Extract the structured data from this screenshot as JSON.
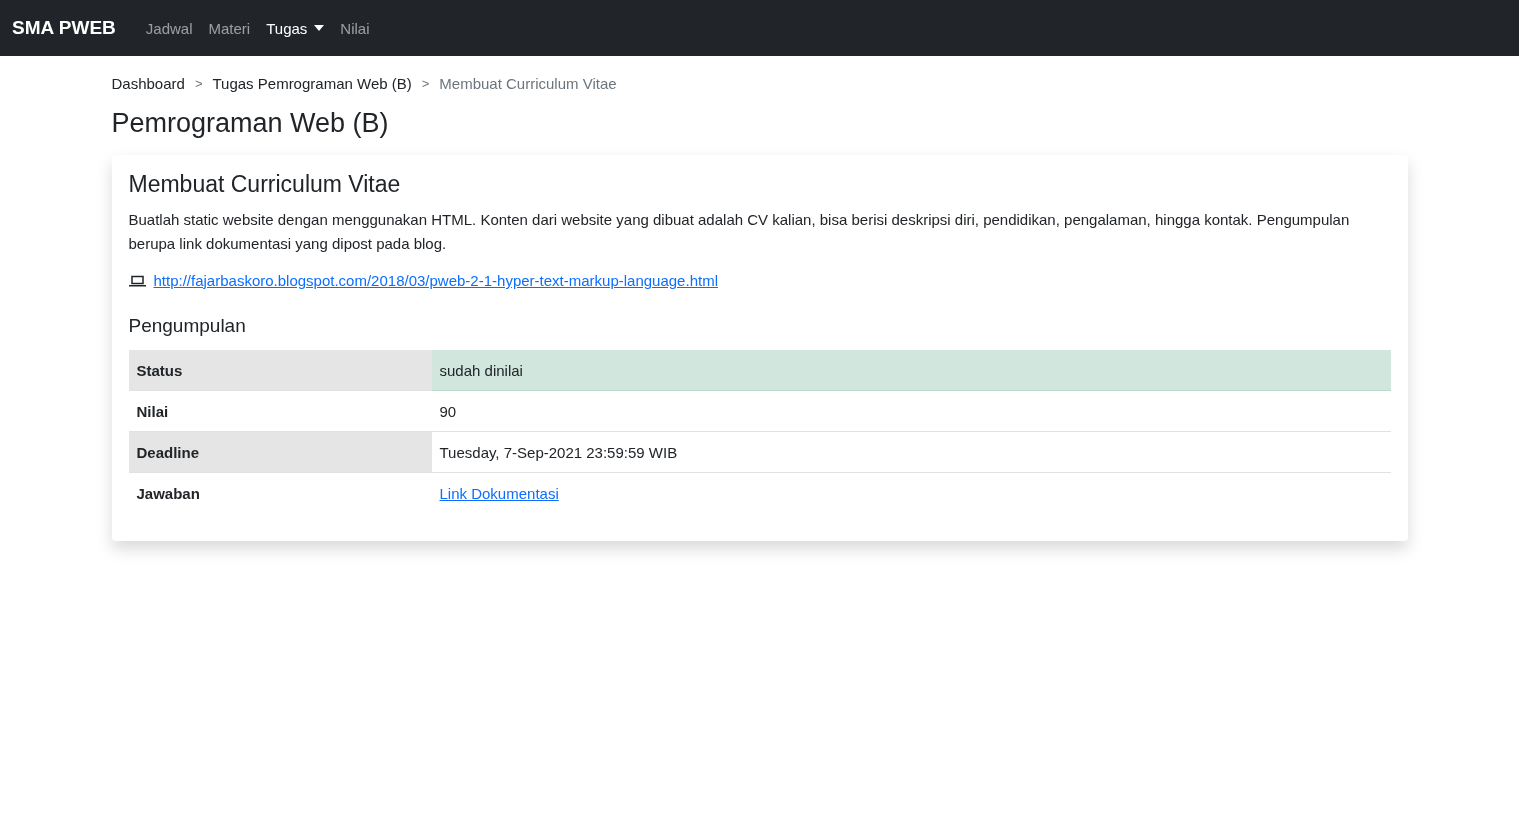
{
  "navbar": {
    "brand": "SMA PWEB",
    "items": [
      {
        "label": "Jadwal",
        "selected": false,
        "dropdown": false
      },
      {
        "label": "Materi",
        "selected": false,
        "dropdown": false
      },
      {
        "label": "Tugas",
        "selected": true,
        "dropdown": true
      },
      {
        "label": "Nilai",
        "selected": false,
        "dropdown": false
      }
    ]
  },
  "breadcrumb": [
    {
      "label": "Dashboard",
      "selected": false
    },
    {
      "label": "Tugas Pemrograman Web (B)",
      "selected": false
    },
    {
      "label": "Membuat Curriculum Vitae",
      "selected": true
    }
  ],
  "breadcrumb_separator": ">",
  "page_title": "Pemrograman Web (B)",
  "card": {
    "title": "Membuat Curriculum Vitae",
    "description": "Buatlah static website dengan menggunakan HTML. Konten dari website yang dibuat adalah CV kalian, bisa berisi deskripsi diri, pendidikan, pengalaman, hingga kontak. Pengumpulan berupa link dokumentasi yang dipost pada blog.",
    "reference_link": "http://fajarbaskoro.blogspot.com/2018/03/pweb-2-1-hyper-text-markup-language.html",
    "section_title": "Pengumpulan",
    "rows": [
      {
        "label": "Status",
        "value": "sudah dinilai",
        "kind": "status"
      },
      {
        "label": "Nilai",
        "value": "90",
        "kind": "text"
      },
      {
        "label": "Deadline",
        "value": "Tuesday, 7-Sep-2021 23:59:59 WIB",
        "kind": "text"
      },
      {
        "label": "Jawaban",
        "value": "Link Dokumentasi",
        "kind": "link"
      }
    ]
  }
}
